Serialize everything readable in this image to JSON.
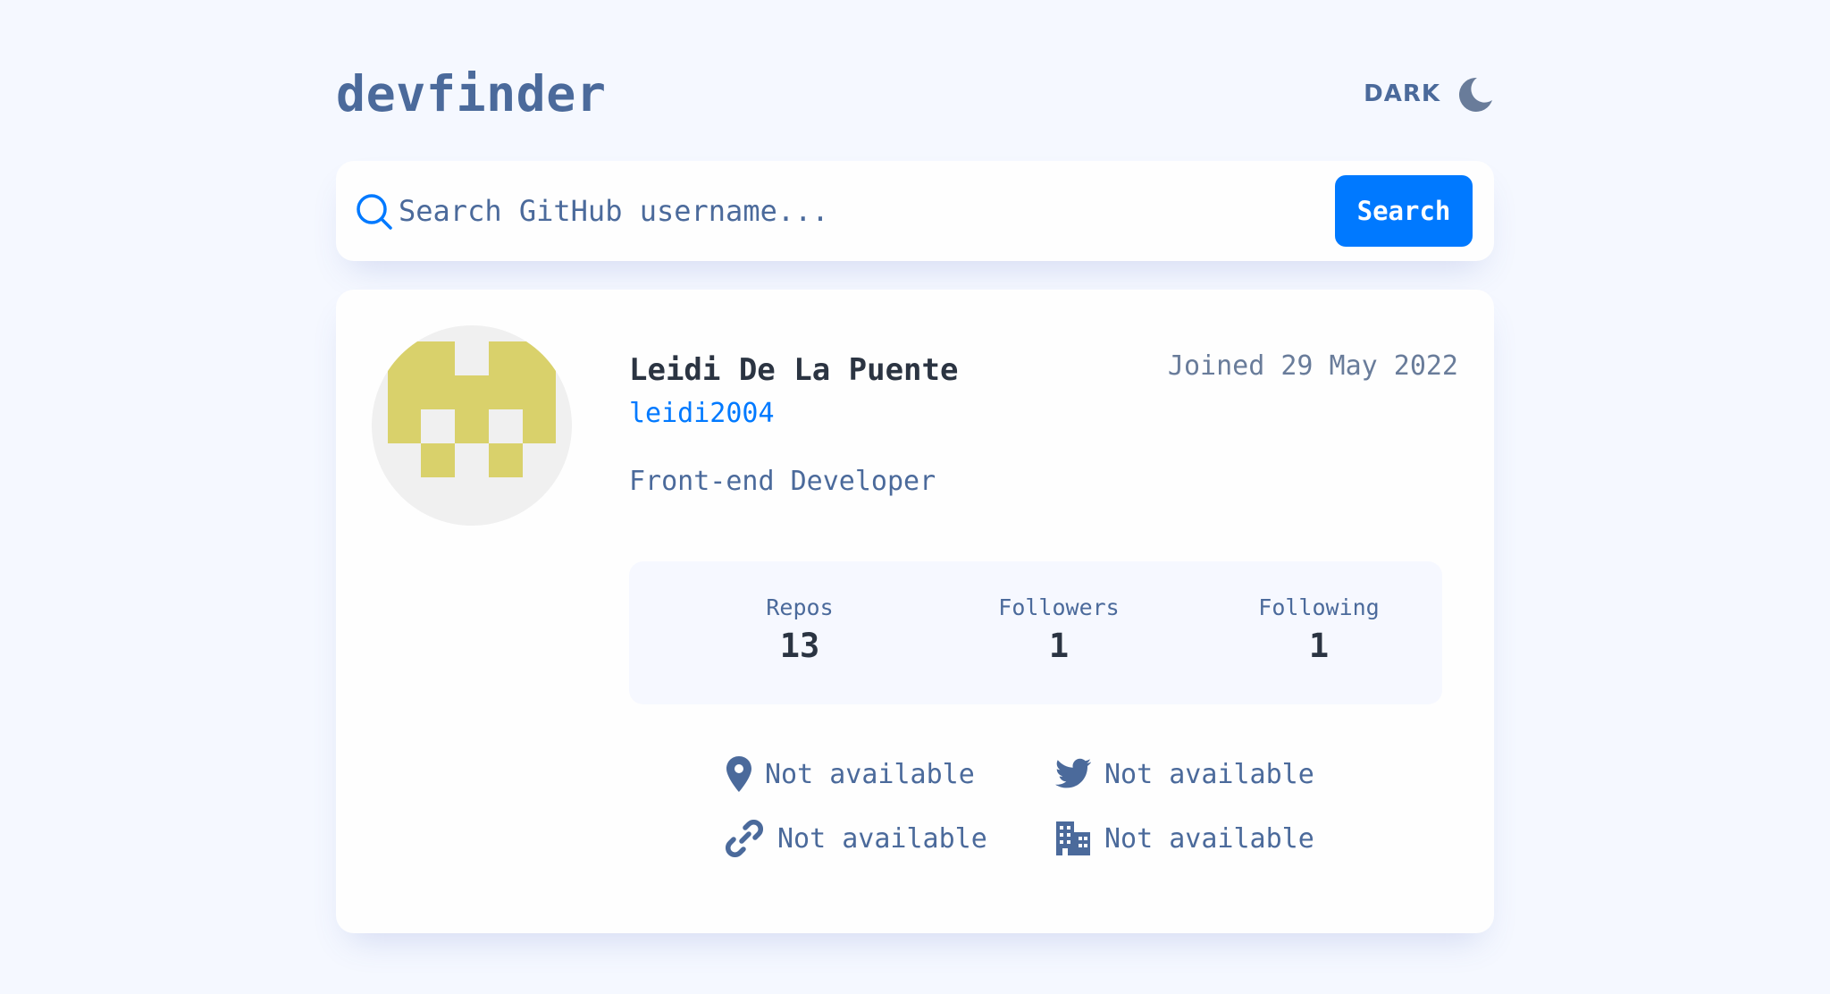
{
  "header": {
    "logo": "devfinder",
    "theme_toggle_label": "DARK",
    "theme_icon": "moon-icon"
  },
  "search": {
    "icon": "search-icon",
    "placeholder": "Search GitHub username...",
    "value": "",
    "button_label": "Search"
  },
  "profile": {
    "name": "Leidi De La Puente",
    "login": "leidi2004",
    "joined": "Joined 29 May 2022",
    "bio": "Front-end Developer",
    "avatar_colors": {
      "background": "#F0F0F0",
      "foreground": "#D9D16B"
    },
    "stats": [
      {
        "label": "Repos",
        "value": "13"
      },
      {
        "label": "Followers",
        "value": "1"
      },
      {
        "label": "Following",
        "value": "1"
      }
    ],
    "links": [
      {
        "icon": "location-icon",
        "text": "Not available"
      },
      {
        "icon": "twitter-icon",
        "text": "Not available"
      },
      {
        "icon": "link-icon",
        "text": "Not available"
      },
      {
        "icon": "company-icon",
        "text": "Not available"
      }
    ]
  },
  "colors": {
    "accent": "#0079FF",
    "text_primary": "#2B3442",
    "text_secondary": "#4B6A9B",
    "background": "#F5F8FF",
    "card": "#FEFEFE"
  }
}
